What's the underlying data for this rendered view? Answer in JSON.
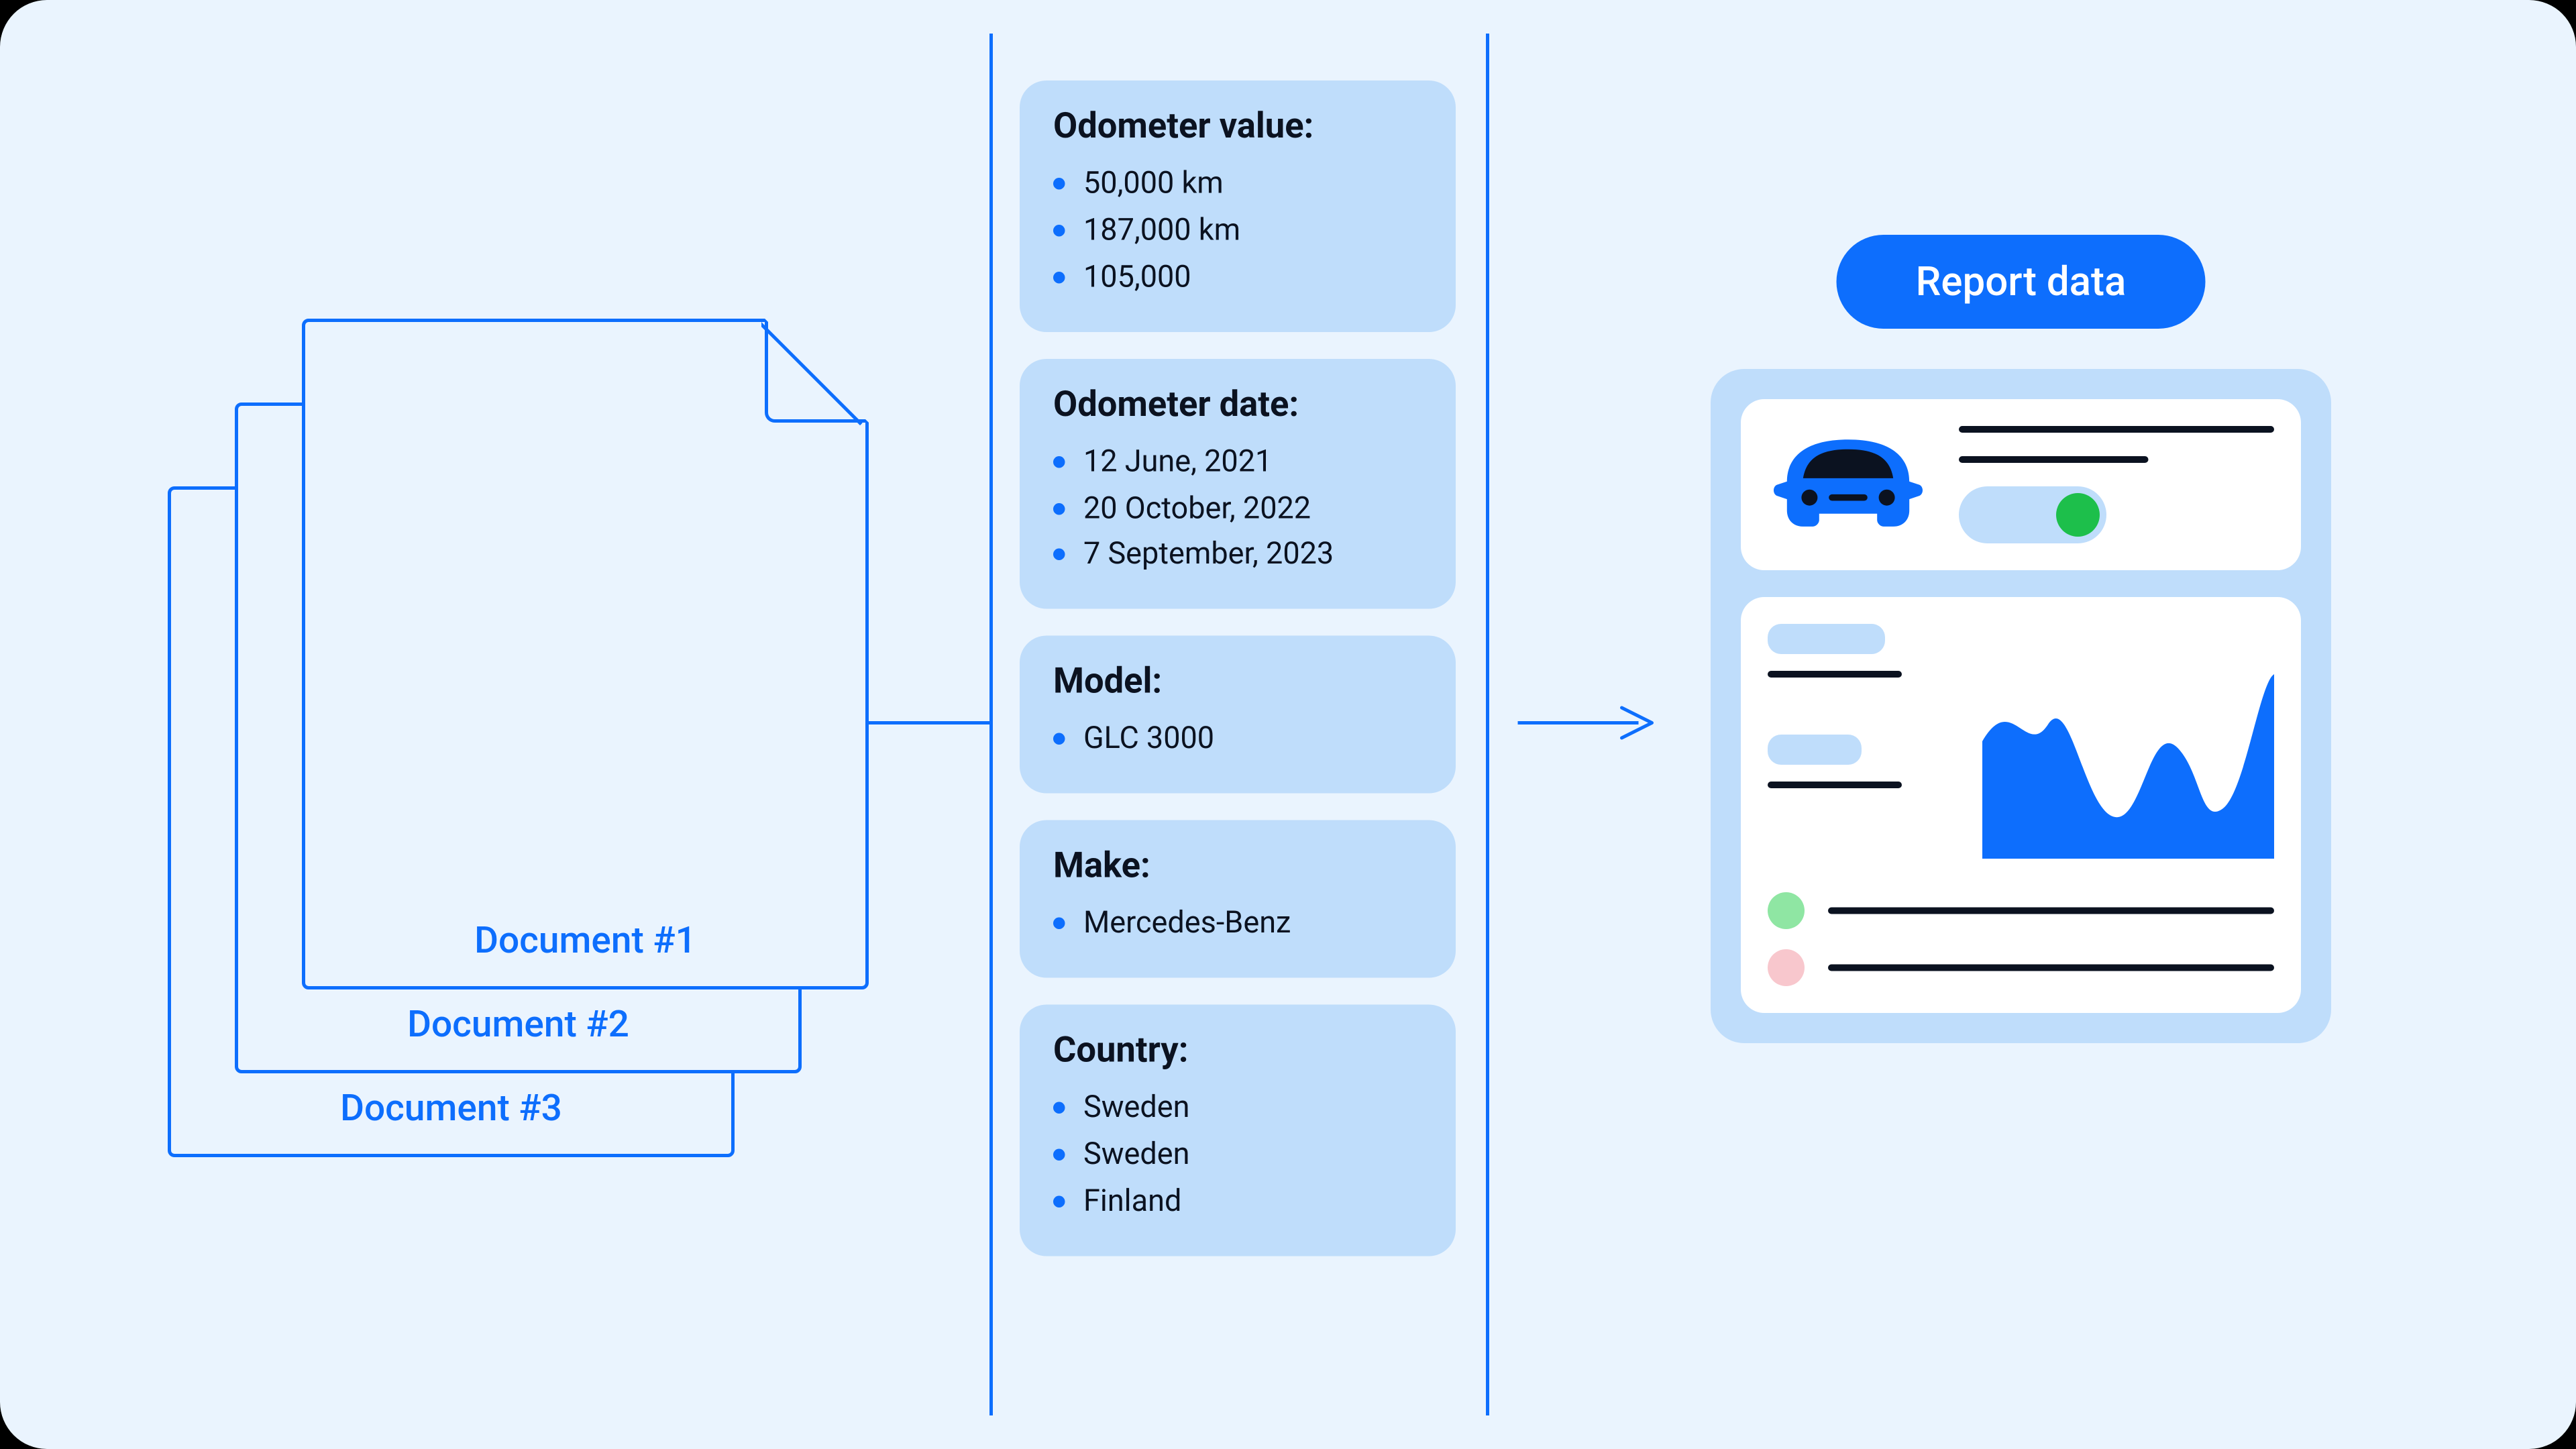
{
  "documents": {
    "items": [
      {
        "label": "Document #1"
      },
      {
        "label": "Document #2"
      },
      {
        "label": "Document #3"
      }
    ]
  },
  "extracted": {
    "odometer_value": {
      "title": "Odometer value:",
      "items": [
        "50,000 km",
        "187,000 km",
        "105,000"
      ]
    },
    "odometer_date": {
      "title": "Odometer date:",
      "items": [
        "12 June, 2021",
        "20 October, 2022",
        "7 September, 2023"
      ]
    },
    "model": {
      "title": "Model:",
      "items": [
        "GLC 3000"
      ]
    },
    "make": {
      "title": "Make:",
      "items": [
        "Mercedes-Benz"
      ]
    },
    "country": {
      "title": "Country:",
      "items": [
        "Sweden",
        "Sweden",
        "Finland"
      ]
    }
  },
  "report": {
    "pill_label": "Report data"
  },
  "colors": {
    "bg": "#EAF4FE",
    "accent": "#0D6EFD",
    "card": "#BFDDFB",
    "text": "#0B1220",
    "green": "#1DBF4B",
    "legend_green": "#8FE6A3",
    "legend_pink": "#F8C7CD"
  }
}
